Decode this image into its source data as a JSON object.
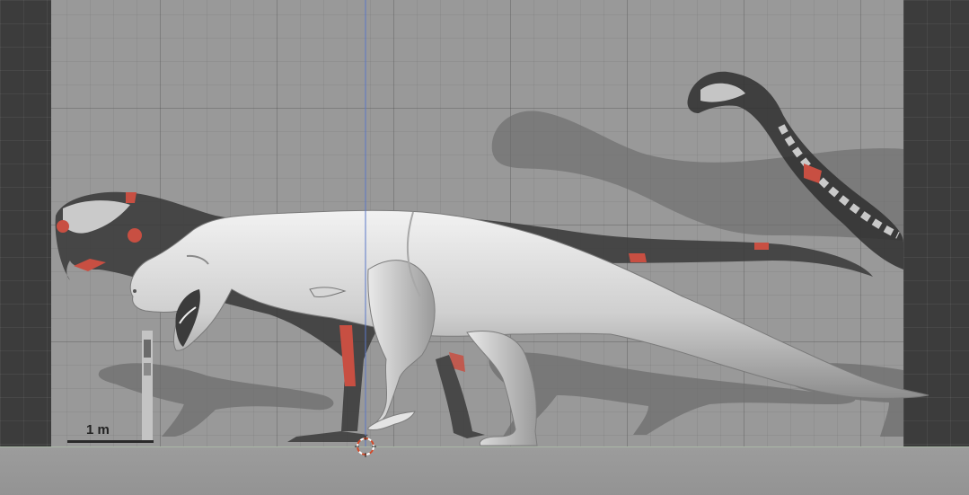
{
  "viewport": {
    "scale_bar": {
      "label": "1 m"
    },
    "colors": {
      "background": "#404040",
      "reference_image": "#999999",
      "model_surface": "#d6d6d6",
      "bone_highlight": "#d2493e",
      "axis_line": "#5a78c8",
      "cursor": "#d24a2a"
    },
    "objects": [
      {
        "name": "theropod-3d-model",
        "type": "sculpt"
      },
      {
        "name": "skeletal-reference-theropod",
        "type": "reference-image"
      },
      {
        "name": "sauropod-silhouette",
        "type": "reference-image"
      },
      {
        "name": "human-scale-figure",
        "type": "reference-image"
      },
      {
        "name": "3d-cursor",
        "icon": "crosshair-icon"
      }
    ]
  }
}
